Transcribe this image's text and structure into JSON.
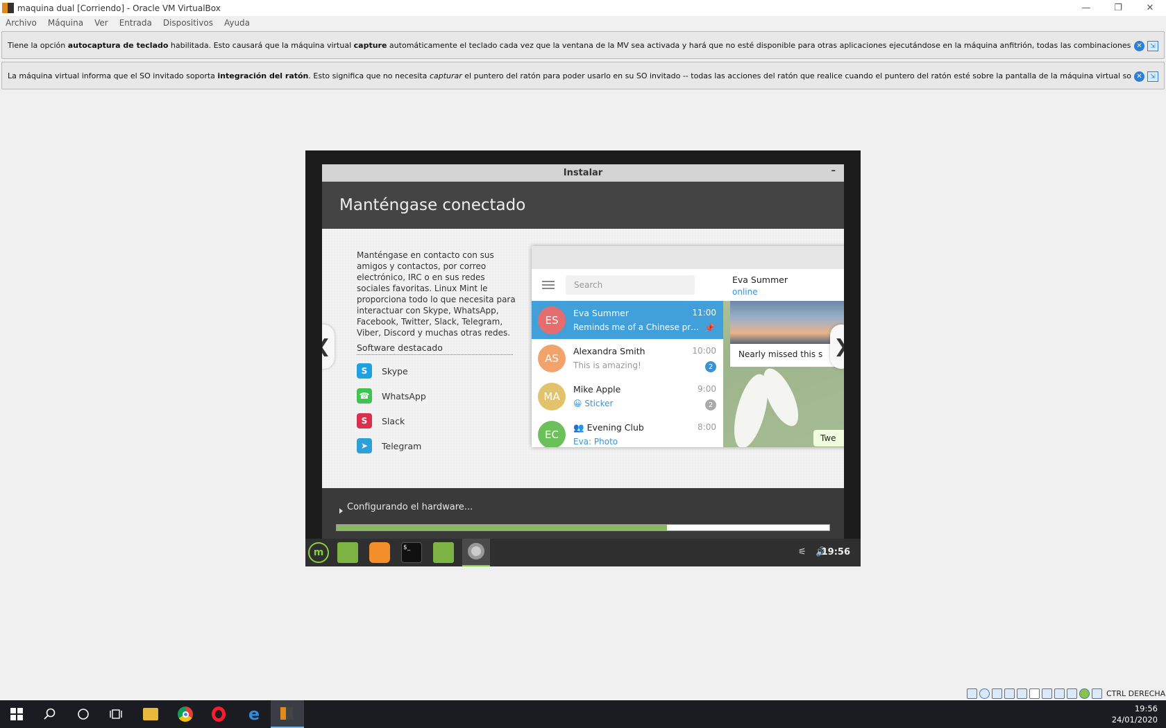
{
  "window": {
    "title": "maquina dual [Corriendo] - Oracle VM VirtualBox",
    "controls": [
      "—",
      "❐",
      "✕"
    ]
  },
  "menubar": [
    "Archivo",
    "Máquina",
    "Ver",
    "Entrada",
    "Dispositivos",
    "Ayuda"
  ],
  "notices": {
    "keyboard": {
      "pre": "Tiene la opción ",
      "b1": "autocaptura de teclado",
      "mid": " habilitada. Esto causará que la máquina virtual ",
      "b2": "capture",
      "post": " automáticamente el teclado cada vez que la ventana de la MV sea activada y hará que no esté disponible para otras aplicaciones ejecutándose en la máquina anfitrión, todas las combinaciones de teclas (incluyendo las del sistema como"
    },
    "mouse": {
      "pre": "La máquina virtual informa que el SO invitado soporta ",
      "b1": "integración del ratón",
      "mid": ". Esto significa que no necesita ",
      "i1": "capturar",
      "post": " el puntero del ratón para poder usarlo en su SO invitado -- todas las acciones del ratón que realice cuando el puntero del ratón esté sobre la pantalla de la máquina virtual son enviadas directamente al SO invitado. Si el"
    }
  },
  "installer": {
    "window_title": "Instalar",
    "minimize": "–",
    "heading": "Manténgase conectado",
    "description": "Manténgase en contacto con sus amigos y contactos, por correo electrónico, IRC o en sus redes sociales favoritas. Linux Mint le proporciona todo lo que necesita para interactuar con Skype, WhatsApp, Facebook, Twitter, Slack, Telegram, Viber, Discord y muchas otras redes.",
    "featured_heading": "Software destacado",
    "software": [
      {
        "name": "Skype",
        "icon": "skype-icon",
        "color": "#1da1e2",
        "glyph": "S"
      },
      {
        "name": "WhatsApp",
        "icon": "whatsapp-icon",
        "color": "#3fc453",
        "glyph": "☎"
      },
      {
        "name": "Slack",
        "icon": "slack-icon",
        "color": "#d9304f",
        "glyph": "S"
      },
      {
        "name": "Telegram",
        "icon": "telegram-icon",
        "color": "#2d9fd9",
        "glyph": "➤"
      }
    ],
    "prev": "❮",
    "next": "❯",
    "status": "Configurando el hardware...",
    "progress": 0.67
  },
  "telegram": {
    "search_placeholder": "Search",
    "chats": [
      {
        "initials": "ES",
        "name": "Eva Summer",
        "msg": "Reminds me of a Chinese proverb",
        "time": "11:00",
        "color": "#e66d6d",
        "active": true,
        "pinned": true
      },
      {
        "initials": "AS",
        "name": "Alexandra Smith",
        "msg": "This is amazing!",
        "time": "10:00",
        "color": "#f2a36b",
        "badge": "2",
        "badge_color": "#3a92d0"
      },
      {
        "initials": "MA",
        "name": "Mike Apple",
        "msg": "Sticker",
        "emoji": "😀",
        "time": "9:00",
        "color": "#e2c36b",
        "badge": "2",
        "badge_color": "#aaaaaa"
      },
      {
        "initials": "EC",
        "name": "Evening Club",
        "msg": "Eva: Photo",
        "time": "8:00",
        "color": "#6cc05a",
        "group": true
      }
    ],
    "conversation": {
      "name": "Eva Summer",
      "status": "online",
      "caption": "Nearly missed this s",
      "bubble": "Twe"
    }
  },
  "mint_panel": {
    "clock": "19:56"
  },
  "vbox_status": {
    "label": "CTRL DERECHA"
  },
  "taskbar": {
    "time": "19:56",
    "date": "24/01/2020"
  }
}
